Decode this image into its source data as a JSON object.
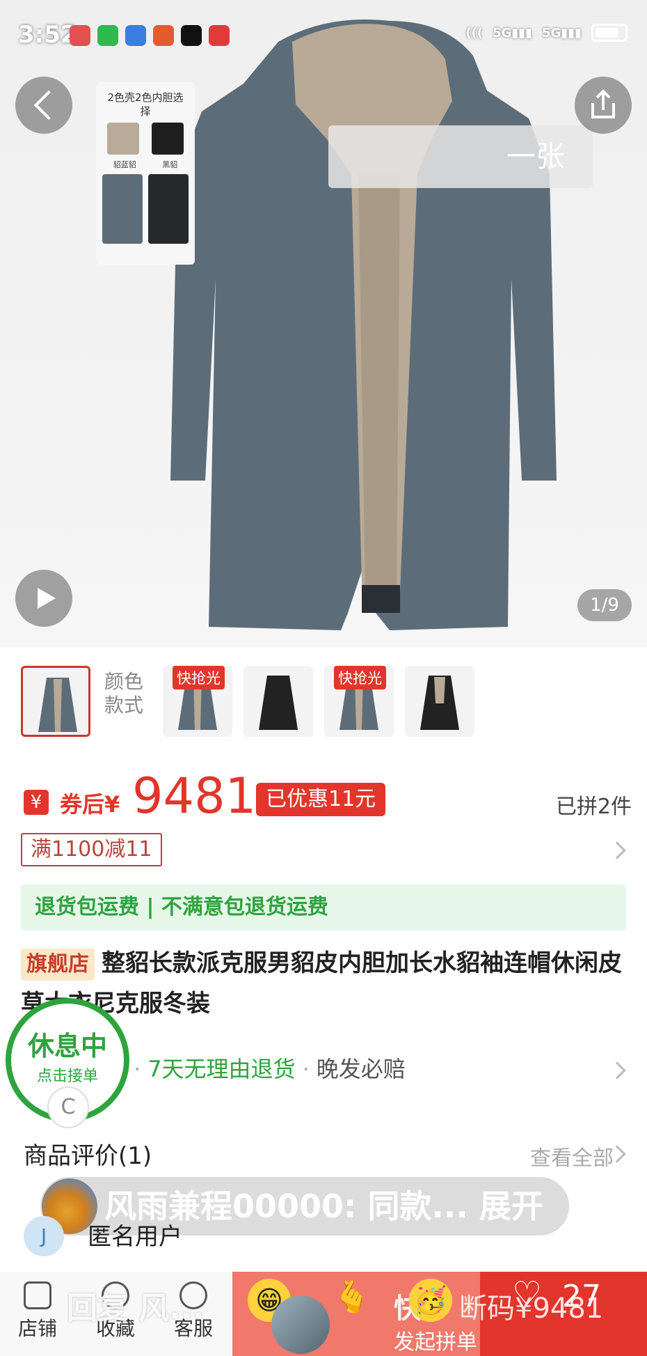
{
  "status_bar": {
    "time": "3:52"
  },
  "gallery": {
    "counter": "1/9",
    "overlay_text": "一张",
    "variant_card": {
      "title": "2色壳2色内胆选择",
      "swatch_labels": [
        "貂蓝貂",
        "黑貂"
      ]
    }
  },
  "thumbnails": {
    "color_label": "颜色款式",
    "tags": [
      "快抢光",
      "快抢光"
    ]
  },
  "price": {
    "badge": "¥",
    "after_coupon": "券后¥",
    "value": "9481",
    "saved": "已优惠11元",
    "joined": "已拼2件"
  },
  "coupon": {
    "label": "满1100减11"
  },
  "return_bar": {
    "text": "退货包运费 | 不满意包退货运费"
  },
  "title": {
    "flag": "旗舰店",
    "text": "整貂长款派克服男貂皮内胆加长水貂袖连帽休闲皮草大衣尼克服冬装"
  },
  "services": {
    "first": "费",
    "second": "7天无理由退货",
    "third": "晚发必赔"
  },
  "rest_badge": {
    "title": "休息中",
    "subtitle": "点击接单",
    "c": "C"
  },
  "reviews": {
    "title": "商品评价(1)",
    "view_all": "查看全部",
    "bullet": "风雨兼程00000: 同款... 展开",
    "anon": "匿名用户"
  },
  "bottom_bar": {
    "tabs": [
      "店铺",
      "收藏",
      "客服"
    ],
    "reply_overlay": "回复 风...",
    "cta_main": "快",
    "cta_sub": "发起拼单",
    "price_overlay": "断码¥9481",
    "likes": "27"
  }
}
